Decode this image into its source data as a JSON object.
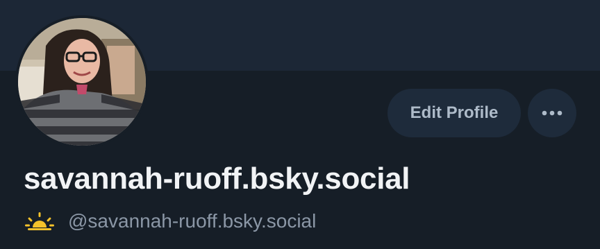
{
  "profile": {
    "display_name": "savannah-ruoff.bsky.social",
    "handle": "@savannah-ruoff.bsky.social",
    "status_emoji": "sun-icon"
  },
  "actions": {
    "edit_label": "Edit Profile",
    "more_icon": "ellipsis-icon"
  },
  "colors": {
    "background": "#161e27",
    "banner": "#1c2736",
    "button_bg": "#1e2b3b",
    "button_text": "#aebbc9",
    "name_text": "#f1f3f5",
    "handle_text": "#8b97a6",
    "sun": "#f4c22b"
  }
}
